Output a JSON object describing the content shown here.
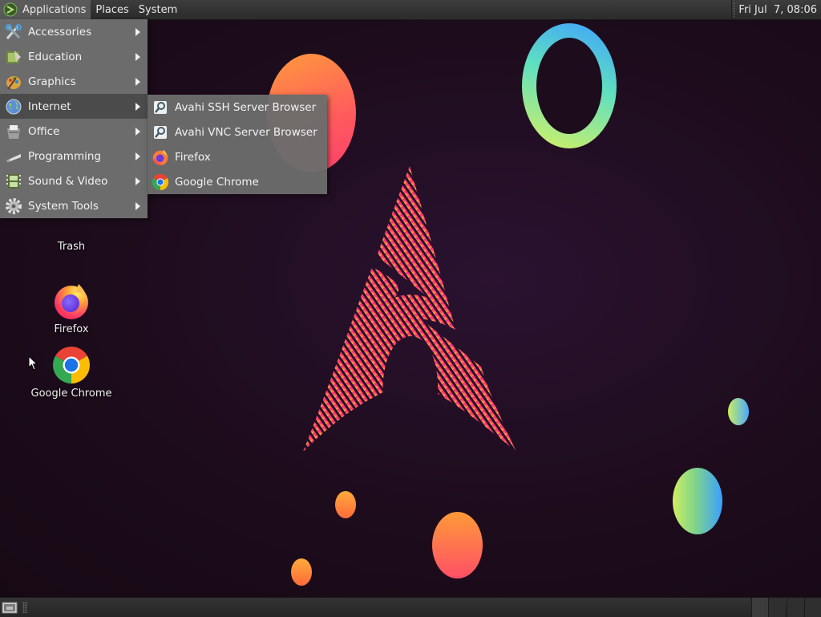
{
  "top_panel": {
    "menus": {
      "applications": "Applications",
      "places": "Places",
      "system": "System"
    },
    "clock": "Fri Jul  7, 08:06"
  },
  "applications_menu": {
    "items": [
      {
        "label": "Accessories",
        "icon": "accessories-icon"
      },
      {
        "label": "Education",
        "icon": "education-icon"
      },
      {
        "label": "Graphics",
        "icon": "graphics-icon"
      },
      {
        "label": "Internet",
        "icon": "internet-globe-icon",
        "highlighted": true
      },
      {
        "label": "Office",
        "icon": "office-icon"
      },
      {
        "label": "Programming",
        "icon": "programming-icon"
      },
      {
        "label": "Sound & Video",
        "icon": "sound-video-icon"
      },
      {
        "label": "System Tools",
        "icon": "system-tools-gear-icon"
      }
    ]
  },
  "internet_submenu": {
    "items": [
      {
        "label": "Avahi SSH Server Browser",
        "icon": "avahi-ssh-icon"
      },
      {
        "label": "Avahi VNC Server Browser",
        "icon": "avahi-vnc-icon"
      },
      {
        "label": "Firefox",
        "icon": "firefox-icon"
      },
      {
        "label": "Google Chrome",
        "icon": "chrome-icon"
      }
    ]
  },
  "desktop_icons": [
    {
      "label": "Trash",
      "icon": "trash-icon"
    },
    {
      "label": "Firefox",
      "icon": "firefox-icon"
    },
    {
      "label": "Google Chrome",
      "icon": "chrome-icon"
    }
  ],
  "colors": {
    "panel_bg": "#2e2e2e",
    "menu_bg": "#707070",
    "menu_highlight": "#4b4b4b",
    "wallpaper_bg": "#1d0c1c"
  }
}
